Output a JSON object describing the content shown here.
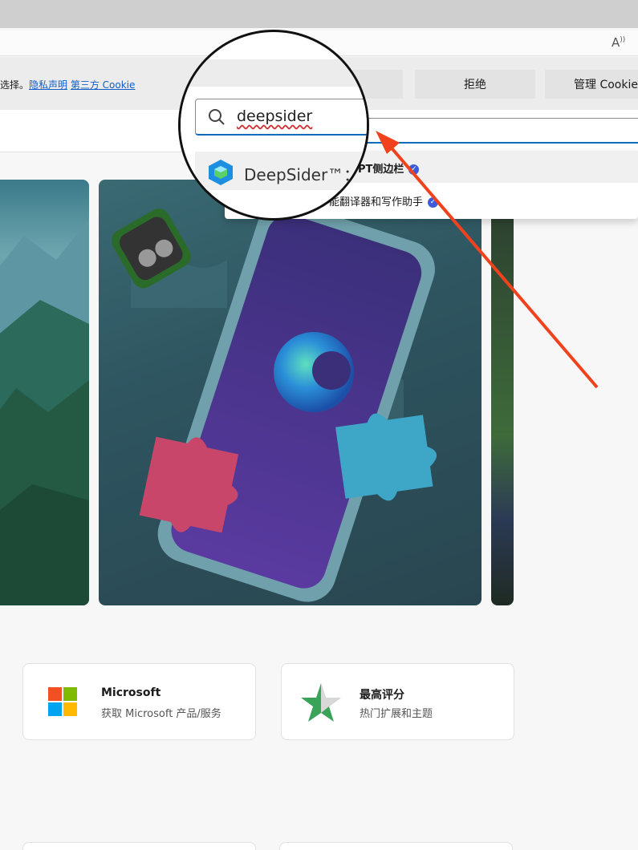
{
  "browser": {
    "read_aloud_icon": "read-aloud-icon"
  },
  "cookie_banner": {
    "text_prefix": "选择。",
    "privacy_link": "隐私声明",
    "third_party_link": "第三方 Cookie",
    "reject_label": "拒绝",
    "manage_label": "管理 Cookie"
  },
  "search": {
    "query": "deepsider",
    "suggestions": [
      {
        "label": "DeepSider™：",
        "rest": "PT侧边栏",
        "verified": true
      },
      {
        "label": "",
        "rest": "能翻译器和写作助手",
        "verified": true
      }
    ]
  },
  "feature_cards": [
    {
      "title": "Microsoft",
      "subtitle": "获取 Microsoft 产品/服务",
      "icon": "microsoft-logo-icon"
    },
    {
      "title": "最高评分",
      "subtitle": "热门扩展和主题",
      "icon": "star-icon"
    }
  ],
  "colors": {
    "accent": "#0f6cbd",
    "arrow": "#f0421c",
    "link": "#0f5ec6",
    "verified": "#3b5bdb"
  }
}
